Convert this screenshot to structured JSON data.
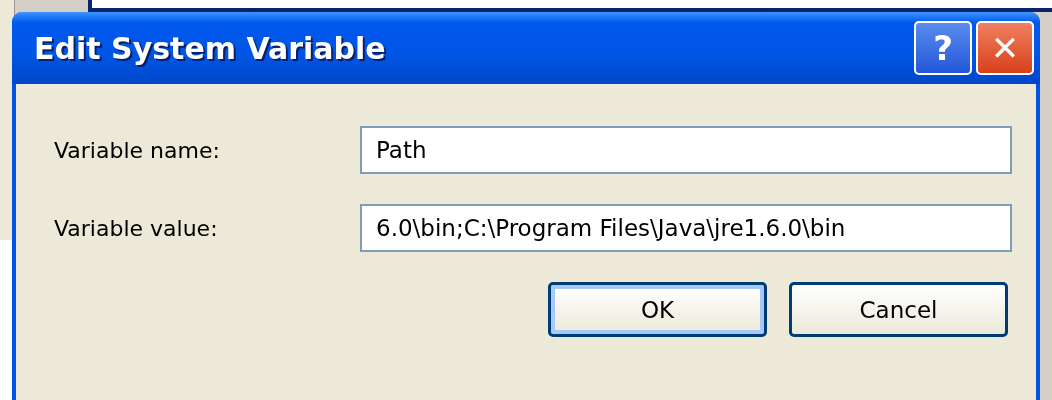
{
  "window": {
    "title": "Edit System Variable"
  },
  "title_buttons": [
    {
      "kind": "help",
      "label": "?"
    },
    {
      "kind": "close",
      "label": "✕"
    }
  ],
  "fields": [
    {
      "label": "Variable name:",
      "value": "Path"
    },
    {
      "label": "Variable value:",
      "value": "6.0\\bin;C:\\Program Files\\Java\\jre1.6.0\\bin"
    }
  ],
  "buttons": [
    {
      "label": "OK",
      "default": true
    },
    {
      "label": "Cancel",
      "default": false
    }
  ]
}
